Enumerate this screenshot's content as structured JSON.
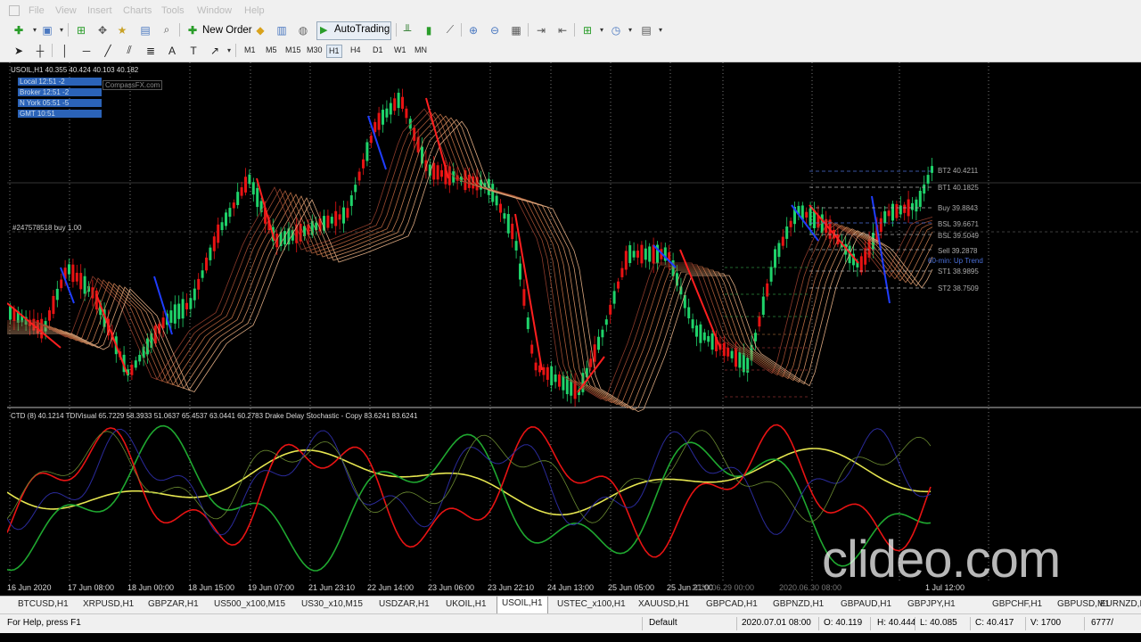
{
  "menu": {
    "items": [
      "File",
      "View",
      "Insert",
      "Charts",
      "Tools",
      "Window",
      "Help"
    ]
  },
  "toolbar": {
    "new_order": "New Order",
    "autotrading": "AutoTrading"
  },
  "timeframes": [
    "M1",
    "M5",
    "M15",
    "M30",
    "H1",
    "H4",
    "D1",
    "W1",
    "MN"
  ],
  "timeframe_active": "H1",
  "chart": {
    "header": "USOIL,H1  40.355 40.424 40.103 40.182",
    "clocks": [
      "Local 12:51 -2",
      "Broker 12:51 -2",
      "N York 05:51 -5",
      "GMT 10:51"
    ],
    "compassfx": "CompassFX.com",
    "order_line": "#247578518 buy 1.00",
    "indicator_header": "CTD (8)  40.1214  TDIVisual 65.7229 58.3933 51.0637 65.4537 63.0441 60.2783  Drake Delay Stochastic - Copy 83.6241 83.6241",
    "levels": [
      "BT2 40.4211",
      "BT1 40.1825",
      "Buy 39.8843",
      "BSL 39.6671",
      "BSL 39.5049",
      "Sell 39.2878",
      "60-min: Up Trend",
      "ST1 38.9895",
      "ST2 38.7509"
    ],
    "level_colors": {
      "gray": "#aaaaaa",
      "blue": "#4a6fd8"
    },
    "x_labels": [
      "16 Jun 2020",
      "17 Jun 08:00",
      "18 Jun 00:00",
      "18 Jun 15:00",
      "19 Jun 07:00",
      "21 Jun 23:10",
      "22 Jun 14:00",
      "23 Jun 06:00",
      "23 Jun 22:10",
      "24 Jun 13:00",
      "25 Jun 05:00",
      "25 Jun 21:00",
      "2020.06.29 00:00",
      "2020.06.30 08:00",
      "1 Jul 12:00"
    ]
  },
  "symbol_tabs": [
    "BTCUSD,H1",
    "XRPUSD,H1",
    "GBPZAR,H1",
    "US500_x100,M15",
    "US30_x10,M15",
    "USDZAR,H1",
    "UKOIL,H1",
    "USOIL,H1",
    "USTEC_x100,H1",
    "XAUUSD,H1",
    "GBPCAD,H1",
    "GBPNZD,H1",
    "GBPAUD,H1",
    "GBPJPY,H1",
    "GBPCHF,H1",
    "GBPUSD,M1",
    "EURNZD,M"
  ],
  "active_tab": "USOIL,H1",
  "status": {
    "help": "For Help, press F1",
    "profile": "Default",
    "datetime": "2020.07.01 08:00",
    "open": "O: 40.119",
    "high": "H: 40.444",
    "low": "L: 40.085",
    "close": "C: 40.417",
    "volume": "V: 1700",
    "traffic": "6777/"
  },
  "watermark": "clideo.com"
}
